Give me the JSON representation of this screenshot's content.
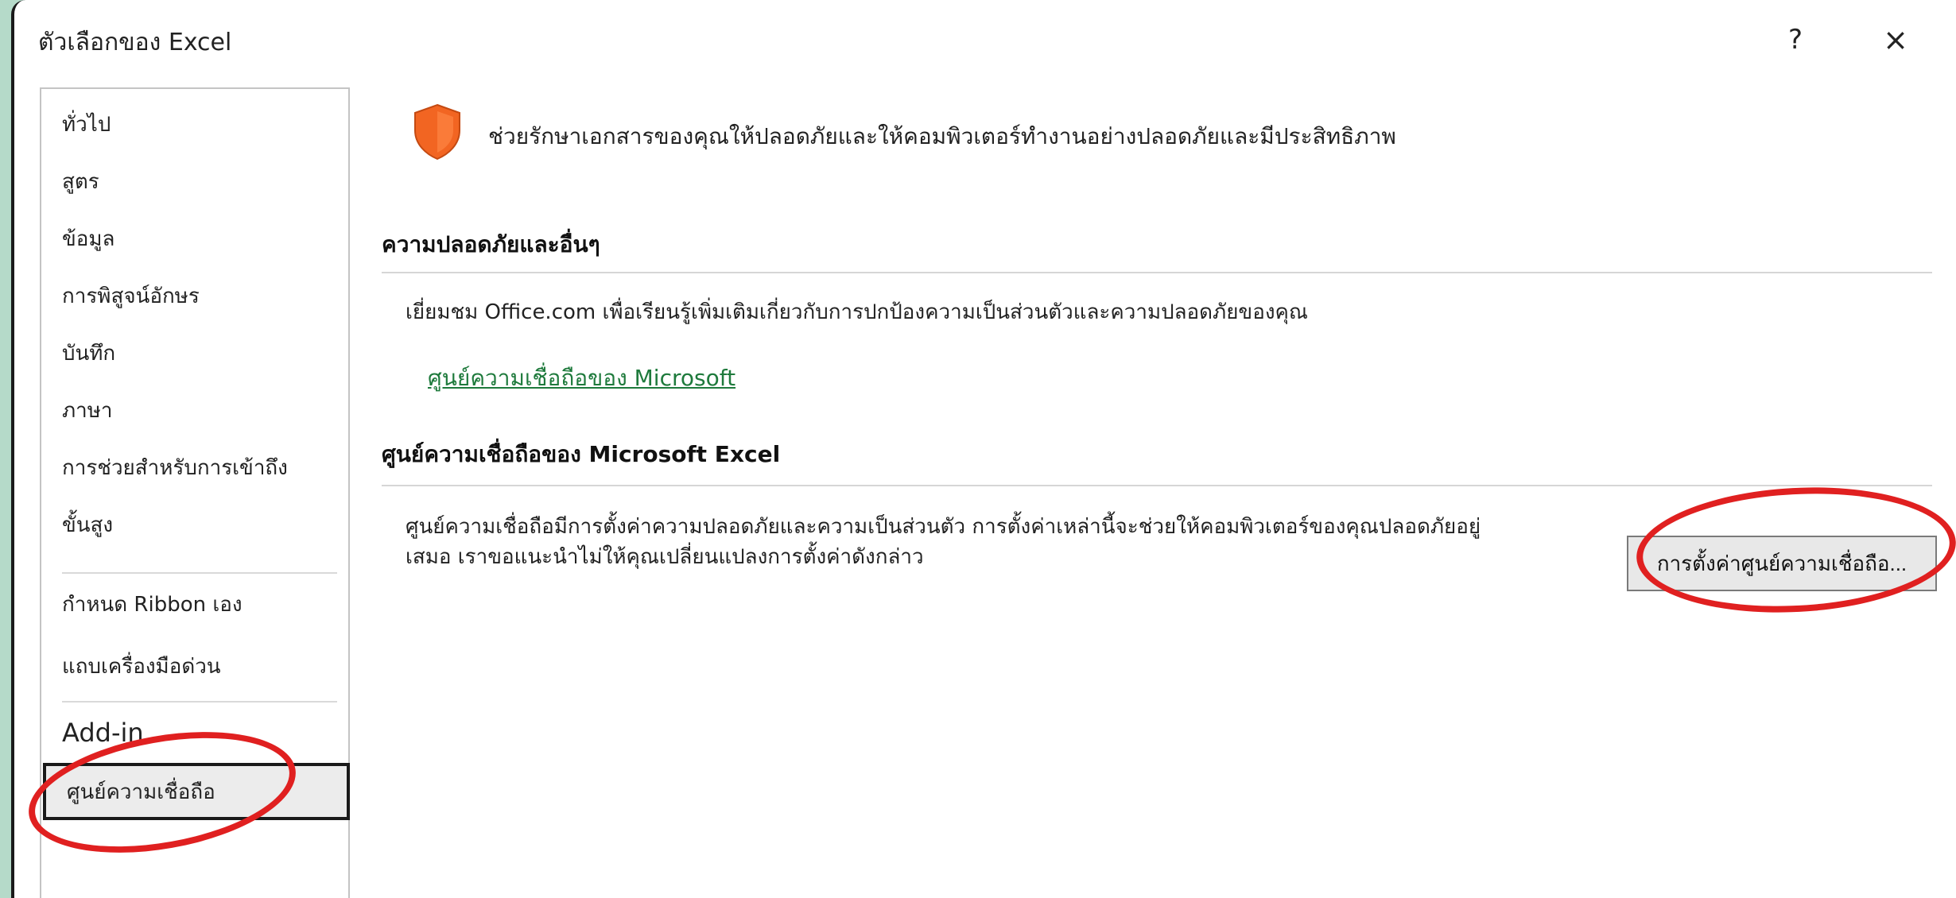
{
  "window": {
    "title": "ตัวเลือกของ Excel",
    "help_label": "?",
    "close_label": "×"
  },
  "sidebar": {
    "items": [
      {
        "label": "ทั่วไป"
      },
      {
        "label": "สูตร"
      },
      {
        "label": "ข้อมูล"
      },
      {
        "label": "การพิสูจน์อักษร"
      },
      {
        "label": "บันทึก"
      },
      {
        "label": "ภาษา"
      },
      {
        "label": "การช่วยสำหรับการเข้าถึง"
      },
      {
        "label": "ขั้นสูง"
      },
      {
        "label": "กำหนด Ribbon เอง"
      },
      {
        "label": "แถบเครื่องมือด่วน"
      },
      {
        "label": "Add-in"
      },
      {
        "label": "ศูนย์ความเชื่อถือ",
        "selected": true
      }
    ]
  },
  "main": {
    "banner_icon": "shield-icon",
    "banner_text": "ช่วยรักษาเอกสารของคุณให้ปลอดภัยและให้คอมพิวเตอร์ทำงานอย่างปลอดภัยและมีประสิทธิภาพ",
    "security": {
      "heading": "ความปลอดภัยและอื่นๆ",
      "description": "เยี่ยมชม Office.com เพื่อเรียนรู้เพิ่มเติมเกี่ยวกับการปกป้องความเป็นส่วนตัวและความปลอดภัยของคุณ",
      "link": "ศูนย์ความเชื่อถือของ Microsoft"
    },
    "trust_center": {
      "heading": "ศูนย์ความเชื่อถือของ Microsoft Excel",
      "description_line1": "ศูนย์ความเชื่อถือมีการตั้งค่าความปลอดภัยและความเป็นส่วนตัว การตั้งค่าเหล่านี้จะช่วยให้คอมพิวเตอร์ของคุณปลอดภัยอยู่",
      "description_line2": "เสมอ เราขอแนะนำไม่ให้คุณเปลี่ยนแปลงการตั้งค่าดังกล่าว",
      "button_label": "การตั้งค่าศูนย์ความเชื่อถือ..."
    }
  },
  "colors": {
    "highlight_red": "#e02020",
    "link_green": "#1e7a3c",
    "shield_orange": "#f26522",
    "background_mint": "#b5dac9"
  }
}
